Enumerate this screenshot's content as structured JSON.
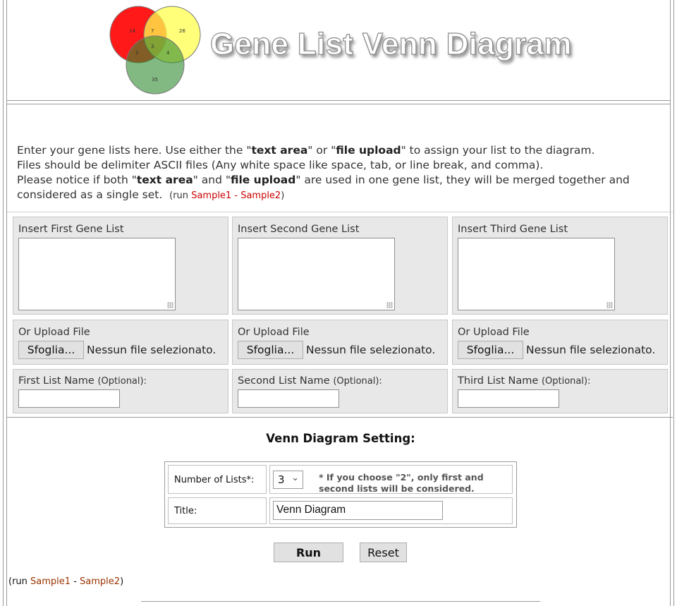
{
  "header": {
    "title": "Gene List Venn Diagram",
    "venn_logo": {
      "labels": [
        "14",
        "7",
        "26",
        "3",
        "2",
        "4",
        "35"
      ],
      "colors": [
        "#ff0000",
        "#ffff4d",
        "#3f9f3f"
      ]
    }
  },
  "intro": {
    "line1_prefix": "Enter your gene lists here. Use either the \"",
    "text_area": "text area",
    "line1_mid": "\" or \"",
    "file_upload": "file upload",
    "line1_suffix": "\" to assign your list to the diagram.",
    "line2": "Files should be delimiter ASCII files (Any white space like space, tab, or line break, and comma).",
    "line3_prefix": "Please notice if both \"",
    "line3_mid": "\" and \"",
    "line3_suffix": "\" are used in one gene list, they will be merged together and considered as a single set.",
    "run_open": "(run",
    "sample1": "Sample1",
    "dash": "-",
    "sample2": "Sample2",
    "run_close": ")"
  },
  "lists": [
    {
      "textarea_label": "Insert First Gene List",
      "upload_label": "Or Upload File",
      "browse_button": "Sfoglia...",
      "file_status": "Nessun file selezionato.",
      "name_label": "First List Name",
      "name_optional": "(Optional):",
      "name_value": ""
    },
    {
      "textarea_label": "Insert Second Gene List",
      "upload_label": "Or Upload File",
      "browse_button": "Sfoglia...",
      "file_status": "Nessun file selezionato.",
      "name_label": "Second List Name",
      "name_optional": "(Optional):",
      "name_value": ""
    },
    {
      "textarea_label": "Insert Third Gene List",
      "upload_label": "Or Upload File",
      "browse_button": "Sfoglia...",
      "file_status": "Nessun file selezionato.",
      "name_label": "Third List Name",
      "name_optional": "(Optional):",
      "name_value": ""
    }
  ],
  "settings": {
    "heading": "Venn Diagram Setting:",
    "number_label": "Number of Lists*:",
    "number_value": "3",
    "note": "* If you choose \"2\", only first and second lists will be considered.",
    "title_label": "Title:",
    "title_value": "Venn Diagram"
  },
  "actions": {
    "run": "Run",
    "reset": "Reset"
  },
  "bottom": {
    "run_open": "(run",
    "sample1": "Sample1",
    "dash": "-",
    "sample2": "Sample2",
    "run_close": ")"
  }
}
